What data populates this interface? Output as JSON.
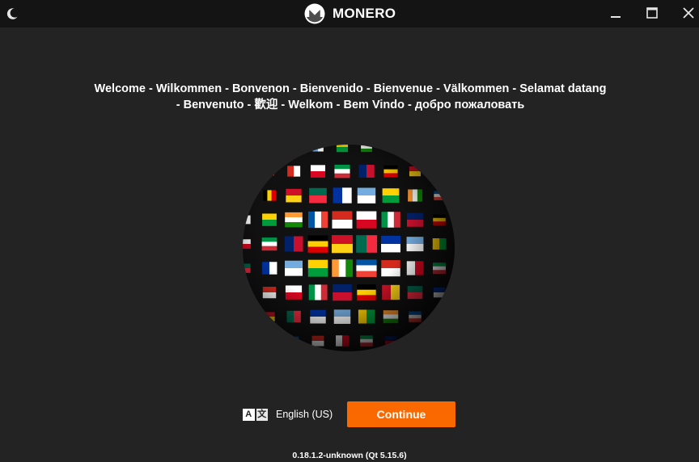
{
  "app": {
    "title": "MONERO",
    "brand_color": "#fa6800"
  },
  "titlebar": {
    "theme_icon": "moon-icon",
    "minimize_icon": "minimize-icon",
    "maximize_icon": "maximize-icon",
    "close_icon": "close-icon"
  },
  "welcome": {
    "line1": "Welcome - Wilkommen - Bonvenon - Bienvenido - Bienvenue - Välkommen - Selamat datang",
    "line2": "- Benvenuto - 歡迎 - Welkom - Bem Vindo - добро пожаловать"
  },
  "globe": {
    "icon": "flags-globe-image"
  },
  "language": {
    "icon_glyph_a": "A",
    "icon_glyph_b": "文",
    "selected": "English (US)"
  },
  "continue_label": "Continue",
  "version": "0.18.1.2-unknown (Qt 5.15.6)"
}
